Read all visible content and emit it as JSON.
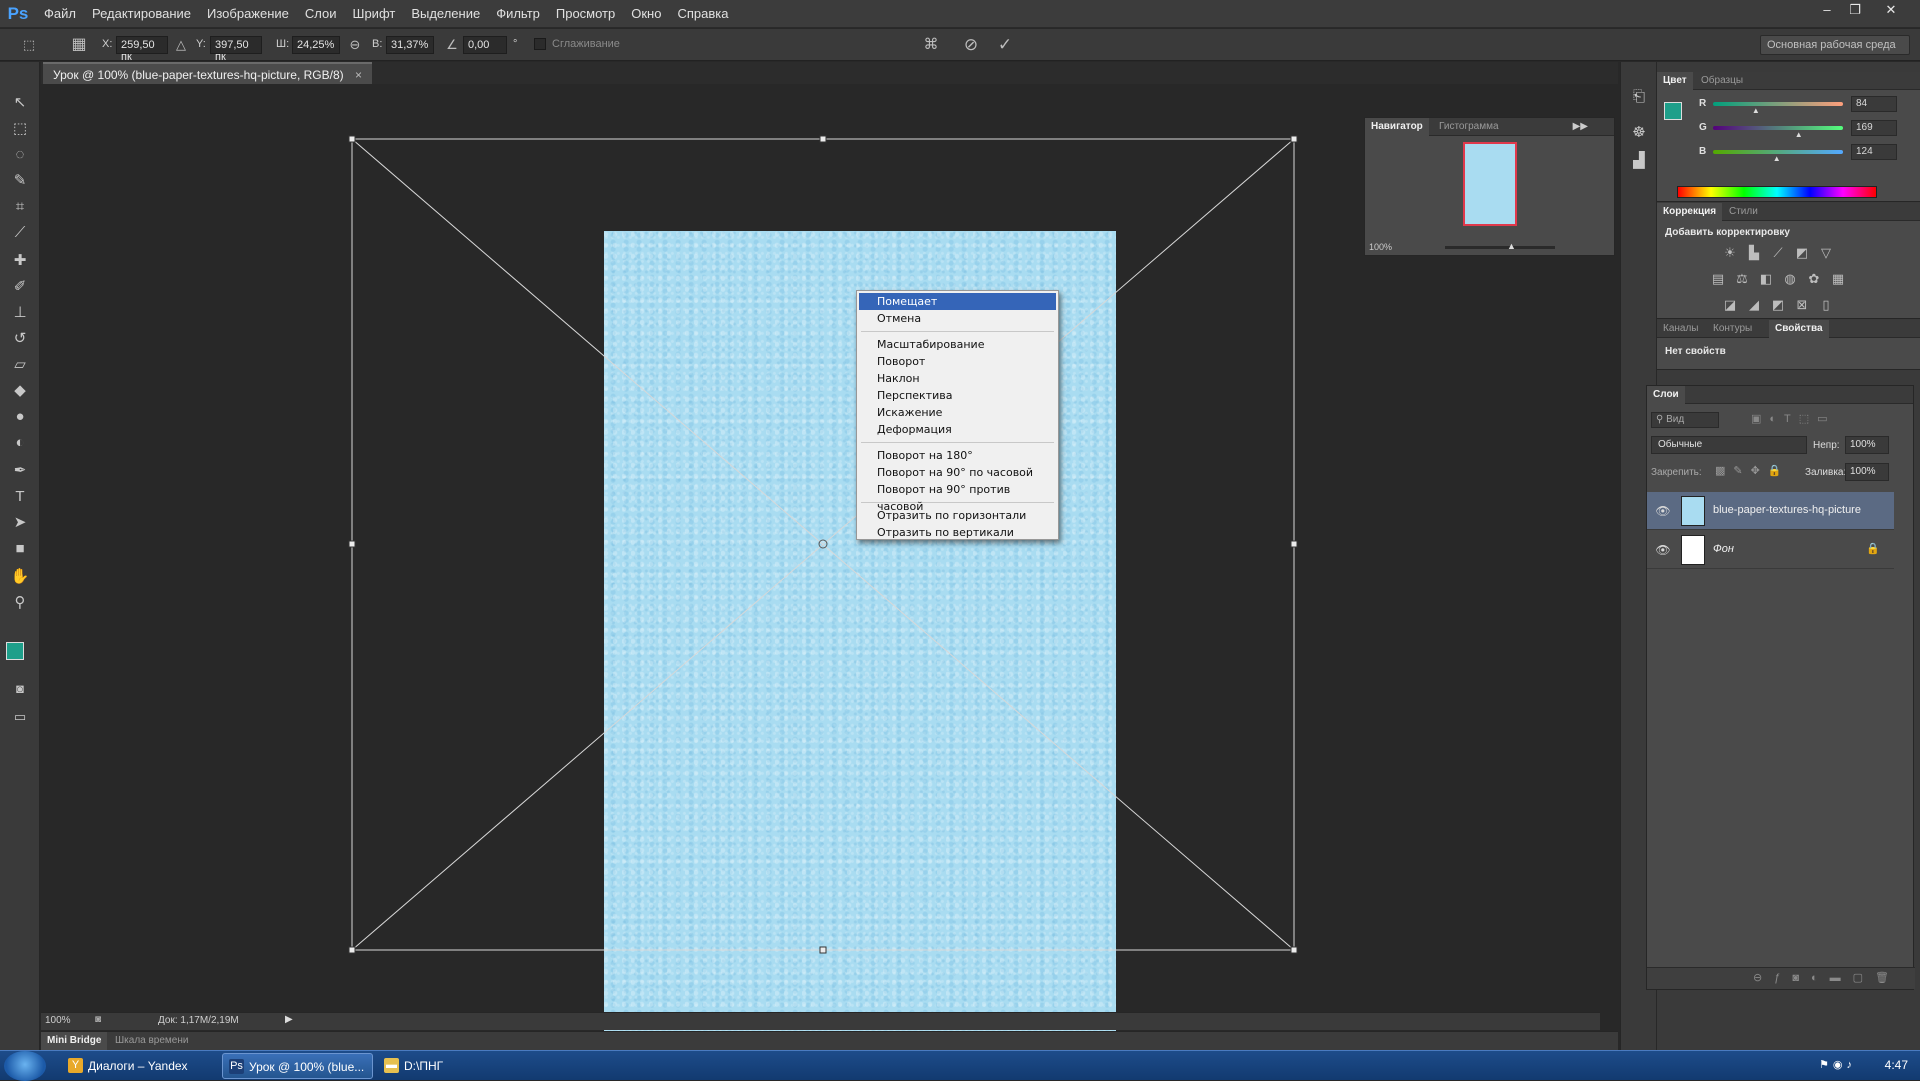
{
  "app": {
    "logo": "Ps",
    "menu": [
      "Файл",
      "Редактирование",
      "Изображение",
      "Слои",
      "Шрифт",
      "Выделение",
      "Фильтр",
      "Просмотр",
      "Окно",
      "Справка"
    ],
    "window_controls": [
      "–",
      "❐",
      "✕"
    ]
  },
  "options_bar": {
    "x_label": "X:",
    "x_value": "259,50 пк",
    "y_label": "Y:",
    "y_value": "397,50 пк",
    "w_label": "Ш:",
    "w_value": "24,25%",
    "h_label": "В:",
    "h_value": "31,37%",
    "angle_value": "0,00",
    "angle_unit": "°",
    "antialias_label": "Сглаживание",
    "workspace": "Основная рабочая среда"
  },
  "document": {
    "tab_title": "Урок @ 100% (blue-paper-textures-hq-picture, RGB/8)",
    "tab_close": "×"
  },
  "context_menu": {
    "groups": [
      [
        "Помещает",
        "Отмена"
      ],
      [
        "Масштабирование",
        "Поворот",
        "Наклон",
        "Перспектива",
        "Искажение",
        "Деформация"
      ],
      [
        "Поворот на 180°",
        "Поворот на 90° по часовой",
        "Поворот на 90° против часовой"
      ],
      [
        "Отразить по горизонтали",
        "Отразить по вертикали"
      ]
    ],
    "selected": "Помещает"
  },
  "navigator": {
    "tabs": [
      "Навигатор",
      "Гистограмма"
    ],
    "zoom": "100%"
  },
  "color_panel": {
    "tabs": [
      "Цвет",
      "Образцы"
    ],
    "foreground": "#1e9f8a",
    "background": "#ffffff",
    "channels": [
      {
        "label": "R",
        "value": "84",
        "level": 0.33
      },
      {
        "label": "G",
        "value": "169",
        "level": 0.66
      },
      {
        "label": "B",
        "value": "124",
        "level": 0.49
      }
    ]
  },
  "adjustments_panel": {
    "tabs": [
      "Коррекция",
      "Стили"
    ],
    "title": "Добавить корректировку"
  },
  "properties_panel": {
    "tabs": [
      "Каналы",
      "Контуры",
      "Свойства"
    ],
    "empty_text": "Нет свойств"
  },
  "layers_panel": {
    "title": "Слои",
    "filter_label": "Вид",
    "blend_mode": "Обычные",
    "opacity_label": "Непр:",
    "opacity": "100%",
    "lock_label": "Закрепить:",
    "fill_label": "Заливка:",
    "fill": "100%",
    "layers": [
      {
        "name": "blue-paper-textures-hq-picture",
        "selected": true,
        "thumb_color": "#a9dcf1"
      },
      {
        "name": "Фон",
        "selected": false,
        "thumb_color": "#ffffff",
        "locked": true
      }
    ]
  },
  "status_bar": {
    "zoom": "100%",
    "doc_info": "Док: 1,17M/2,19M"
  },
  "bottom_tabs": [
    "Mini Bridge",
    "Шкала времени"
  ],
  "taskbar": {
    "items": [
      {
        "label": "Диалоги – Yandex",
        "icon": "Y",
        "icon_color": "#e8a92a",
        "active": false
      },
      {
        "label": "Урок @ 100% (blue...",
        "icon": "Ps",
        "icon_color": "#1c3f77",
        "active": true
      },
      {
        "label": "D:\\ПНГ",
        "icon": "▬",
        "icon_color": "#e6c050",
        "active": false
      }
    ],
    "clock": "4:47"
  }
}
